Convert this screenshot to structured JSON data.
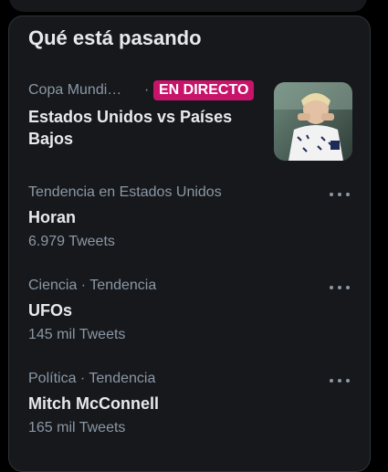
{
  "section": {
    "title": "Qué está pasando"
  },
  "featured": {
    "category": "Copa Mundi…",
    "separator": "·",
    "live_label": "EN DIRECTO",
    "headline": "Estados Unidos vs Países Bajos",
    "thumbnail_icon": "soccer-player-photo"
  },
  "trends": [
    {
      "context": "Tendencia en Estados Unidos",
      "name": "Horan",
      "count": "6.979 Tweets",
      "more_icon": "more-icon"
    },
    {
      "context": "Ciencia · Tendencia",
      "name": "UFOs",
      "count": "145 mil Tweets",
      "more_icon": "more-icon"
    },
    {
      "context": "Política · Tendencia",
      "name": "Mitch McConnell",
      "count": "165 mil Tweets",
      "more_icon": "more-icon"
    }
  ],
  "colors": {
    "background": "#000000",
    "panel": "#16181c",
    "text_primary": "#e7e9ea",
    "text_secondary": "#8b98a5",
    "live_badge": "#c8136b"
  }
}
